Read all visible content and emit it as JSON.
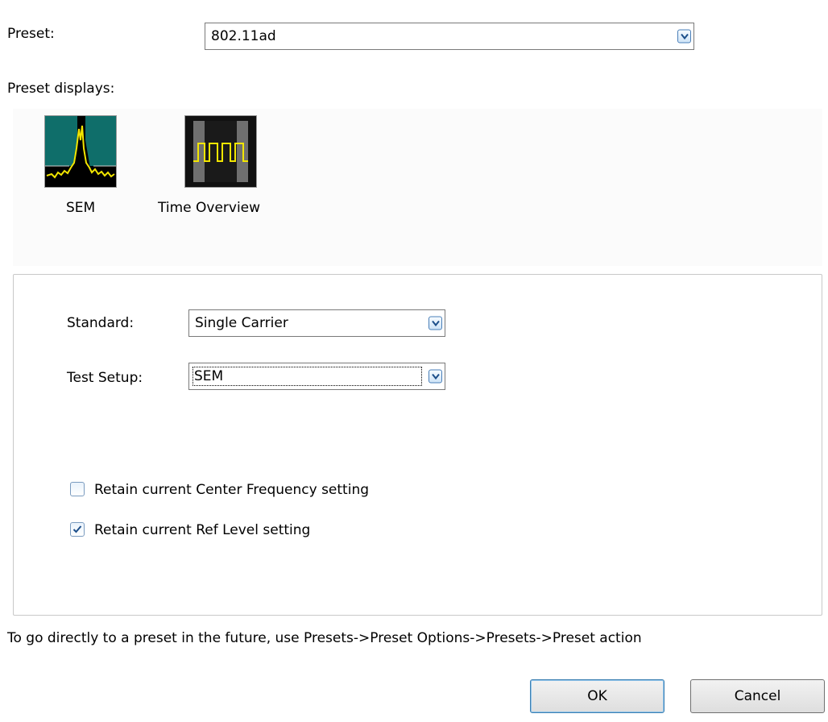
{
  "preset": {
    "label": "Preset:",
    "value": "802.11ad"
  },
  "preset_displays": {
    "label": "Preset displays:",
    "items": [
      {
        "label": "SEM",
        "icon": "sem-spectrum-icon"
      },
      {
        "label": "Time Overview",
        "icon": "time-overview-icon"
      }
    ]
  },
  "settings": {
    "standard": {
      "label": "Standard:",
      "value": "Single Carrier"
    },
    "test_setup": {
      "label": "Test Setup:",
      "value": "SEM"
    },
    "retain_center_frequency": {
      "label": "Retain current Center Frequency setting",
      "checked": false
    },
    "retain_ref_level": {
      "label": "Retain current Ref Level setting",
      "checked": true
    }
  },
  "hint": "To go directly to a preset in the future, use Presets->Preset Options->Presets->Preset action",
  "buttons": {
    "ok": "OK",
    "cancel": "Cancel"
  },
  "colors": {
    "accent": "#4a7fb8",
    "sem_background": "#0f6e6a",
    "trace": "#f2e600"
  }
}
